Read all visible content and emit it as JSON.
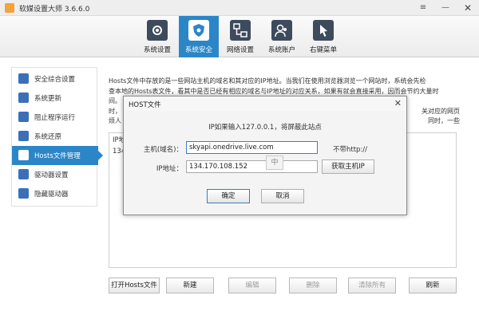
{
  "window": {
    "title": "软媒设置大师 3.6.6.0",
    "controls": {
      "settings": "≡",
      "minimize": "—",
      "close": "✕"
    }
  },
  "toolbar": {
    "tabs": [
      {
        "label": "系统设置",
        "icon": "gears-icon"
      },
      {
        "label": "系统安全",
        "icon": "shield-gear-icon",
        "active": true
      },
      {
        "label": "网络设置",
        "icon": "network-icon"
      },
      {
        "label": "系统账户",
        "icon": "users-icon"
      },
      {
        "label": "右键菜单",
        "icon": "cursor-icon"
      }
    ]
  },
  "sidebar": {
    "items": [
      {
        "label": "安全综合设置",
        "icon": "security-icon"
      },
      {
        "label": "系统更新",
        "icon": "update-icon"
      },
      {
        "label": "阻止程序运行",
        "icon": "block-icon"
      },
      {
        "label": "系统还原",
        "icon": "restore-icon"
      },
      {
        "label": "Hosts文件管理",
        "icon": "hosts-icon",
        "active": true
      },
      {
        "label": "驱动器设置",
        "icon": "drive-icon"
      },
      {
        "label": "隐藏驱动器",
        "icon": "hide-drive-icon"
      }
    ]
  },
  "description": {
    "line1": "Hosts文件中存放的是一些网站主机的域名和其对应的IP地址。当我们在使用浏览器浏览一个网站时，系统会先检",
    "line2": "查本地的Hosts表文件，看其中是否已经有相应的域名与IP地址的对应关系，如果有就会直接采用，因而会节约大量时",
    "line3": "间。",
    "line4_start": "时，",
    "line4_end": "关对应的网页",
    "line5_start": "烦人",
    "line5_end": "同时，一些"
  },
  "list": {
    "header": "IP地",
    "row1": "134"
  },
  "buttons": {
    "open_hosts": "打开Hosts文件",
    "new": "新建",
    "edit": "编辑",
    "delete": "删除",
    "clear_all": "清除所有",
    "refresh": "刷新"
  },
  "dialog": {
    "title": "HOST文件",
    "tip": "IP如果输入127.0.0.1，将屏蔽此站点",
    "host_label": "主机(域名)：",
    "host_value": "skyapi.onedrive.live.com",
    "no_http_note": "不带http://",
    "ip_label": "IP地址：",
    "ip_value": "134.170.108.152",
    "get_ip_button": "获取主机IP",
    "ok_button": "确定",
    "cancel_button": "取消",
    "ime_indicator": "中",
    "close": "✕"
  },
  "colors": {
    "accent": "#2b86c8",
    "icon_dark": "#3d4b5c"
  }
}
